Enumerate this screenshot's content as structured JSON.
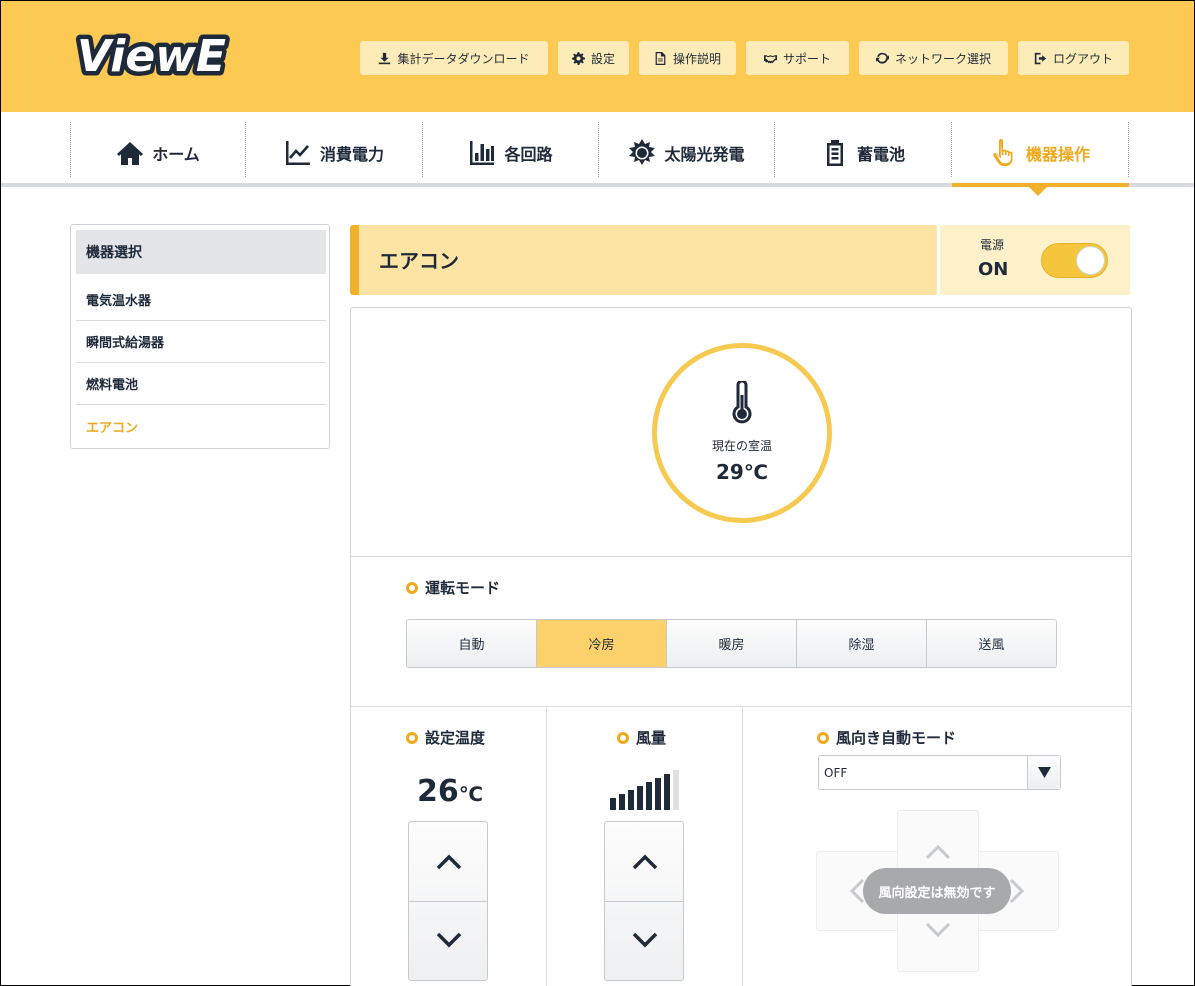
{
  "app": {
    "logo_text": "ViewE"
  },
  "header_buttons": [
    {
      "label": "集計データダウンロード",
      "icon": "download-icon"
    },
    {
      "label": "設定",
      "icon": "gear-icon"
    },
    {
      "label": "操作説明",
      "icon": "document-icon"
    },
    {
      "label": "サポート",
      "icon": "handshake-icon"
    },
    {
      "label": "ネットワーク選択",
      "icon": "refresh-icon"
    },
    {
      "label": "ログアウト",
      "icon": "logout-icon"
    }
  ],
  "nav": {
    "items": [
      {
        "label": "ホーム",
        "icon": "home-icon"
      },
      {
        "label": "消費電力",
        "icon": "line-chart-icon"
      },
      {
        "label": "各回路",
        "icon": "bar-chart-icon"
      },
      {
        "label": "太陽光発電",
        "icon": "sun-icon"
      },
      {
        "label": "蓄電池",
        "icon": "battery-icon"
      },
      {
        "label": "機器操作",
        "icon": "pointer-hand-icon",
        "active": true
      }
    ]
  },
  "sidebar": {
    "heading": "機器選択",
    "items": [
      {
        "label": "電気温水器"
      },
      {
        "label": "瞬間式給湯器"
      },
      {
        "label": "燃料電池"
      },
      {
        "label": "エアコン",
        "active": true
      }
    ]
  },
  "device": {
    "title": "エアコン",
    "power_label": "電源",
    "power_state": "ON"
  },
  "room": {
    "label": "現在の室温",
    "value": "29℃"
  },
  "mode": {
    "title": "運転モード",
    "options": [
      "自動",
      "冷房",
      "暖房",
      "除湿",
      "送風"
    ],
    "selected": "冷房"
  },
  "set_temp": {
    "title": "設定温度",
    "value": "26",
    "unit": "℃"
  },
  "fan": {
    "title": "風量",
    "level": 7,
    "max_level": 8
  },
  "wind_dir": {
    "title": "風向き自動モード",
    "selected": "OFF",
    "disabled_message": "風向設定は無効です"
  },
  "colors": {
    "header_bg": "#fcc952",
    "accent": "#f0a91c",
    "text": "#1e2a3a"
  }
}
